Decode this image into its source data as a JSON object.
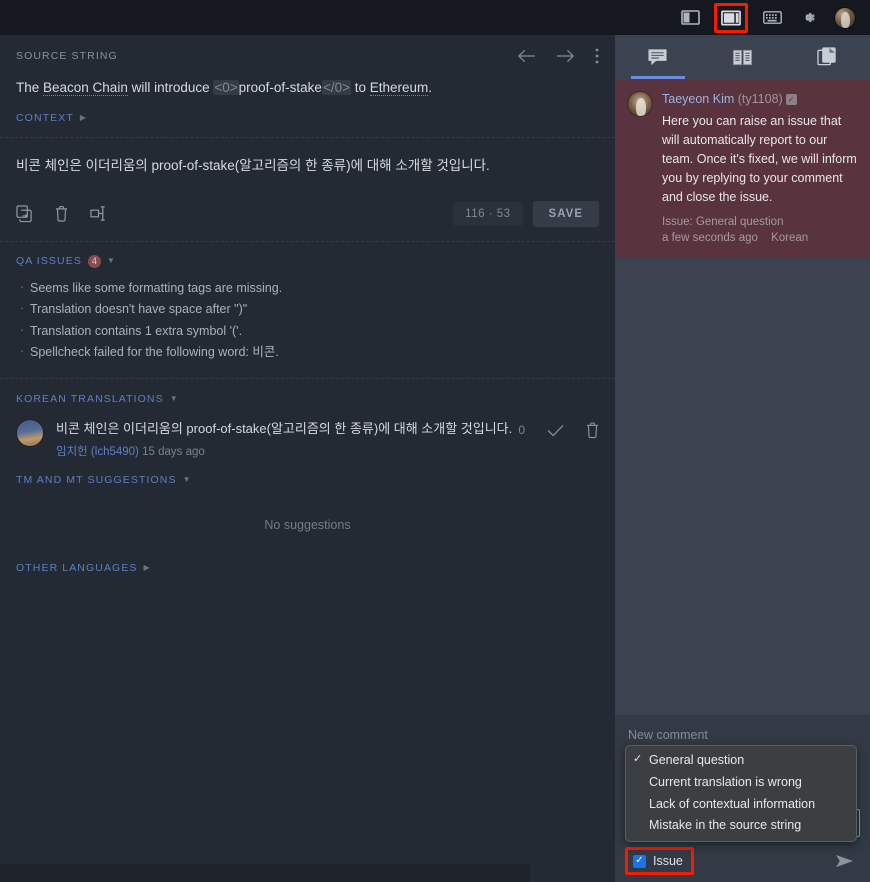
{
  "topbar": {
    "icons": [
      {
        "name": "layout-left-panel-icon",
        "label": "Left panel layout"
      },
      {
        "name": "layout-split-panel-icon",
        "label": "Split panel layout",
        "highlighted": true
      },
      {
        "name": "keyboard-icon",
        "label": "Keyboard shortcuts"
      },
      {
        "name": "gear-icon",
        "label": "Settings"
      },
      {
        "name": "user-avatar",
        "label": "Account"
      }
    ],
    "highlight_color": "#f51d00"
  },
  "editor": {
    "source_label": "SOURCE STRING",
    "nav": {
      "prev_label": "Previous string",
      "next_label": "Next string",
      "more_label": "More options"
    },
    "source_parts": {
      "p1": "The ",
      "spell1": "Beacon Chain",
      "p2": " will introduce ",
      "tag_open": "<0>",
      "p3": "proof-of-stake",
      "tag_close": "</0>",
      "p4": " to ",
      "spell2": "Ethereum",
      "p5": "."
    },
    "context_label": "CONTEXT",
    "translation_value": "비콘 체인은 이더리움의 proof-of-stake(알고리즘의 한 종류)에 대해 소개할 것입니다.",
    "toolbar": {
      "copy_source_label": "Copy source",
      "clear_label": "Clear translation",
      "insert_tag_label": "Insert tag",
      "counter": "116 · 53",
      "save_label": "SAVE"
    },
    "qa": {
      "title": "QA ISSUES",
      "count": "4",
      "items": [
        "Seems like some formatting tags are missing.",
        "Translation doesn't have space after \")\"",
        "Translation contains 1 extra symbol '('.",
        "Spellcheck failed for the following word: 비콘."
      ]
    },
    "korean_translations": {
      "title": "KOREAN TRANSLATIONS",
      "entry": {
        "text": "비콘 체인은 이더리움의 proof-of-stake(알고리즘의 한 종류)에 대해 소개할 것입니다.",
        "user": "임치헌 (lch5490)",
        "time": "15 days ago",
        "votes": "0",
        "approve_label": "Approve",
        "delete_label": "Delete"
      }
    },
    "tm_suggestions": {
      "title": "TM AND MT SUGGESTIONS",
      "empty_text": "No suggestions"
    },
    "other_languages": {
      "title": "OTHER LANGUAGES"
    }
  },
  "right_panel": {
    "tabs": [
      {
        "name": "tab-comments",
        "icon": "comment-icon",
        "label": "Comments",
        "active": true
      },
      {
        "name": "tab-glossary",
        "icon": "book-icon",
        "label": "Glossary",
        "active": false
      },
      {
        "name": "tab-screenshots",
        "icon": "screenshots-icon",
        "label": "Screenshots",
        "active": false
      }
    ],
    "comment": {
      "author": "Taeyeon Kim",
      "handle": "(ty1108)",
      "verified_badge": "✓",
      "body": "Here you can raise an issue that will automatically report to our team. Once it's fixed, we will inform you by replying to your comment and close the issue.",
      "issue_line": "Issue: General question",
      "time": "a few seconds ago",
      "language": "Korean",
      "background_color": "#59333e"
    },
    "composer": {
      "placeholder": "New comment",
      "select_value": "General question",
      "select_border_color": "#4ec39a",
      "dropdown_options": [
        {
          "label": "General question",
          "checked": true
        },
        {
          "label": "Current translation is wrong",
          "checked": false
        },
        {
          "label": "Lack of contextual information",
          "checked": false
        },
        {
          "label": "Mistake in the source string",
          "checked": false
        }
      ],
      "issue_checkbox": {
        "label": "Issue",
        "checked": true,
        "color": "#1a73e8"
      },
      "send_label": "Send",
      "highlight_color": "#f51d00"
    }
  }
}
